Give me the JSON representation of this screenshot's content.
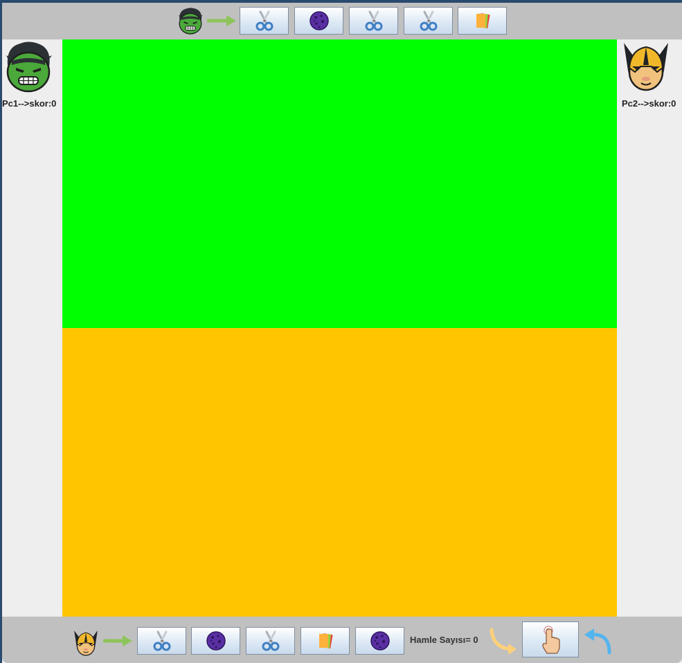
{
  "players": {
    "pc1": {
      "score_text": "Pc1-->skor:0",
      "avatar": "hulk-avatar"
    },
    "pc2": {
      "score_text": "Pc2-->skor:0",
      "avatar": "wolverine-avatar"
    }
  },
  "top_hand": {
    "cards": [
      "scissors",
      "rock",
      "scissors",
      "scissors",
      "paper"
    ]
  },
  "bottom_hand": {
    "cards": [
      "scissors",
      "rock",
      "scissors",
      "paper",
      "rock"
    ]
  },
  "move_count_text": "Hamle Sayısı= 0",
  "board": {
    "top_color": "#00ff00",
    "bottom_color": "#ffc600"
  },
  "icons": {
    "play": "tap-hand-icon",
    "undo": "undo-arrow-icon",
    "forward": "curved-arrow-icon",
    "turn": "green-arrow-icon"
  }
}
